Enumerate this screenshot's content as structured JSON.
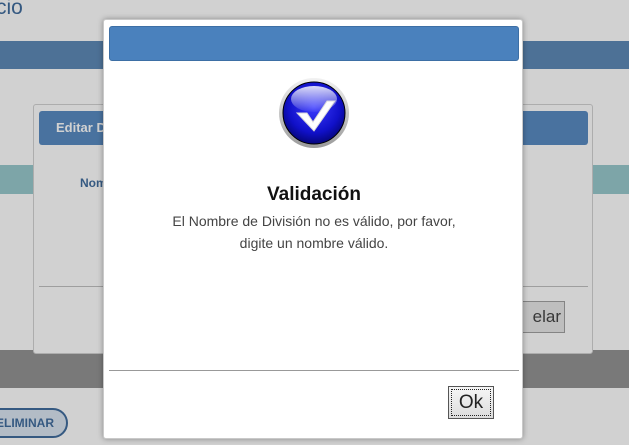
{
  "background": {
    "page_title_fragment": "cio",
    "edit_dialog": {
      "title_fragment": "Editar D",
      "field_label_fragment": "Nom",
      "cancel_fragment": "elar"
    },
    "delete_button_fragment": "ELIMINAR"
  },
  "modal": {
    "icon": "checkmark-icon",
    "title": "Validación",
    "message_line1": "El Nombre de División no es válido, por favor,",
    "message_line2": "digite un nombre válido.",
    "ok_label": "Ok"
  },
  "colors": {
    "header_blue": "#4a81bd",
    "accent_teal": "#8fc4c8",
    "text_blue": "#2f5f95"
  }
}
